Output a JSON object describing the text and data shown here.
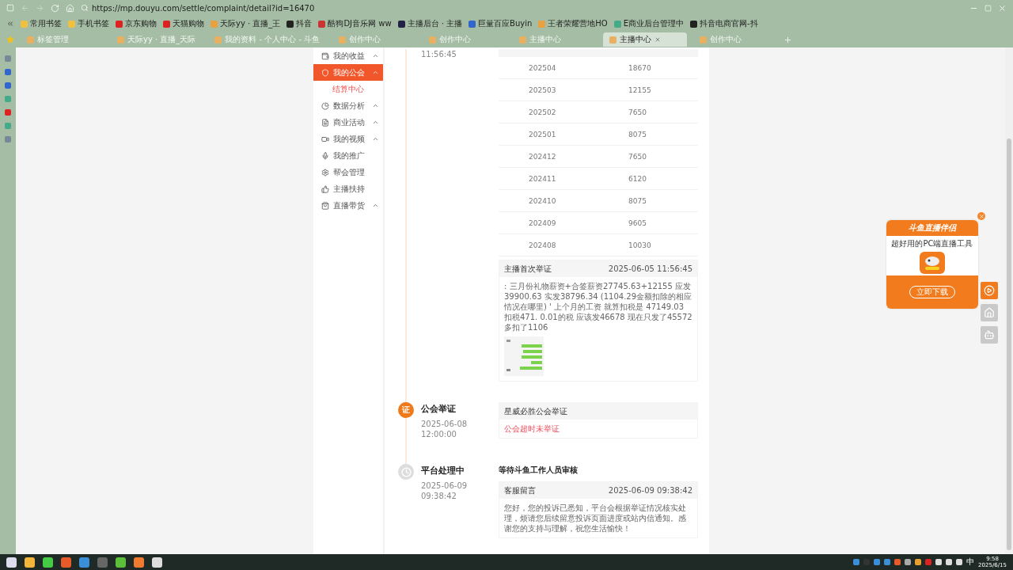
{
  "browser": {
    "url": "https://mp.douyu.com/settle/complaint/detail?id=16470",
    "bookmarks": [
      "常用书签",
      "手机书签",
      "京东购物",
      "天猫购物",
      "天际yy · 直播_王",
      "抖音",
      "酷狗DJ音乐网 ww",
      "主播后台 · 主播",
      "巨量百应Buyin",
      "王者荣耀营地HO",
      "E商业后台管理中",
      "抖音电商官网-抖"
    ],
    "tabs": [
      {
        "label": "标签管理",
        "selected": false
      },
      {
        "label": "天际yy · 直播_天际",
        "selected": false
      },
      {
        "label": "我的资料 - 个人中心 - 斗鱼",
        "selected": false
      },
      {
        "label": "创作中心",
        "selected": false
      },
      {
        "label": "创作中心",
        "selected": false
      },
      {
        "label": "主播中心",
        "selected": false
      },
      {
        "label": "主播中心",
        "selected": true
      },
      {
        "label": "创作中心",
        "selected": false
      }
    ]
  },
  "sidebar": {
    "items": [
      {
        "label": "我的收益",
        "expandable": true,
        "selected": false
      },
      {
        "label": "我的公会",
        "expandable": true,
        "selected": true,
        "children": [
          {
            "label": "结算中心",
            "selected": true
          }
        ]
      },
      {
        "label": "数据分析",
        "expandable": true,
        "selected": false
      },
      {
        "label": "商业活动",
        "expandable": true,
        "selected": false
      },
      {
        "label": "我的视频",
        "expandable": true,
        "selected": false
      },
      {
        "label": "我的推广",
        "expandable": false,
        "selected": false
      },
      {
        "label": "帮会管理",
        "expandable": false,
        "selected": false
      },
      {
        "label": "主播扶持",
        "expandable": false,
        "selected": false
      },
      {
        "label": "直播带货",
        "expandable": true,
        "selected": false
      }
    ]
  },
  "timeline": [
    {
      "kind": "partial",
      "date_lines": [
        "11:56:45"
      ],
      "blocks": [
        {
          "kind": "table",
          "rows": [
            {
              "column_1": "202504",
              "column_2": "18670"
            },
            {
              "column_1": "202503",
              "column_2": "12155"
            },
            {
              "column_1": "202502",
              "column_2": "7650"
            },
            {
              "column_1": "202501",
              "column_2": "8075"
            },
            {
              "column_1": "202412",
              "column_2": "7650"
            },
            {
              "column_1": "202411",
              "column_2": "6120"
            },
            {
              "column_1": "202410",
              "column_2": "8075"
            },
            {
              "column_1": "202409",
              "column_2": "9605"
            },
            {
              "column_1": "202408",
              "column_2": "10030"
            }
          ]
        },
        {
          "kind": "card",
          "title": "主播首次举证",
          "time": "2025-06-05 11:56:45",
          "text": ": 三月份礼物薪资+合签薪资27745.63+12155 应发39900.63 实发38796.34 (1104.29金额扣除的相应情况在哪里) ' 上个月的工资 就算扣税是 47149.03 扣税471. 0.01的税 应该发46678 现在只发了45572 多扣了1106",
          "alert": false
        }
      ]
    },
    {
      "kind": "badge",
      "badge": "证",
      "title": "公会举证",
      "date_lines": [
        "2025-06-08",
        "12:00:00"
      ],
      "blocks": [
        {
          "kind": "card",
          "title": "星威必胜公会举证",
          "text": "公会超时未举证",
          "alert": true
        }
      ]
    },
    {
      "kind": "clock",
      "title": "平台处理中",
      "date_lines": [
        "2025-06-09",
        "09:38:42"
      ],
      "blocks": [
        {
          "kind": "heading",
          "text": "等待斗鱼工作人员审核"
        },
        {
          "kind": "card",
          "title": "客服留言",
          "time": "2025-06-09 09:38:42",
          "text": "您好，您的投诉已悉知，平台会根据举证情况核实处理，烦请您后续留意投诉页面进度或站内信通知。感谢您的支持与理解，祝您生活愉快！",
          "alert": false
        }
      ]
    }
  ],
  "promo": {
    "title": "斗鱼直播伴侣",
    "subtitle": "超好用的PC端直播工具",
    "button": "立即下载"
  },
  "taskbar": {
    "ime": "中",
    "time": "9:58",
    "date": "2025/6/15"
  }
}
